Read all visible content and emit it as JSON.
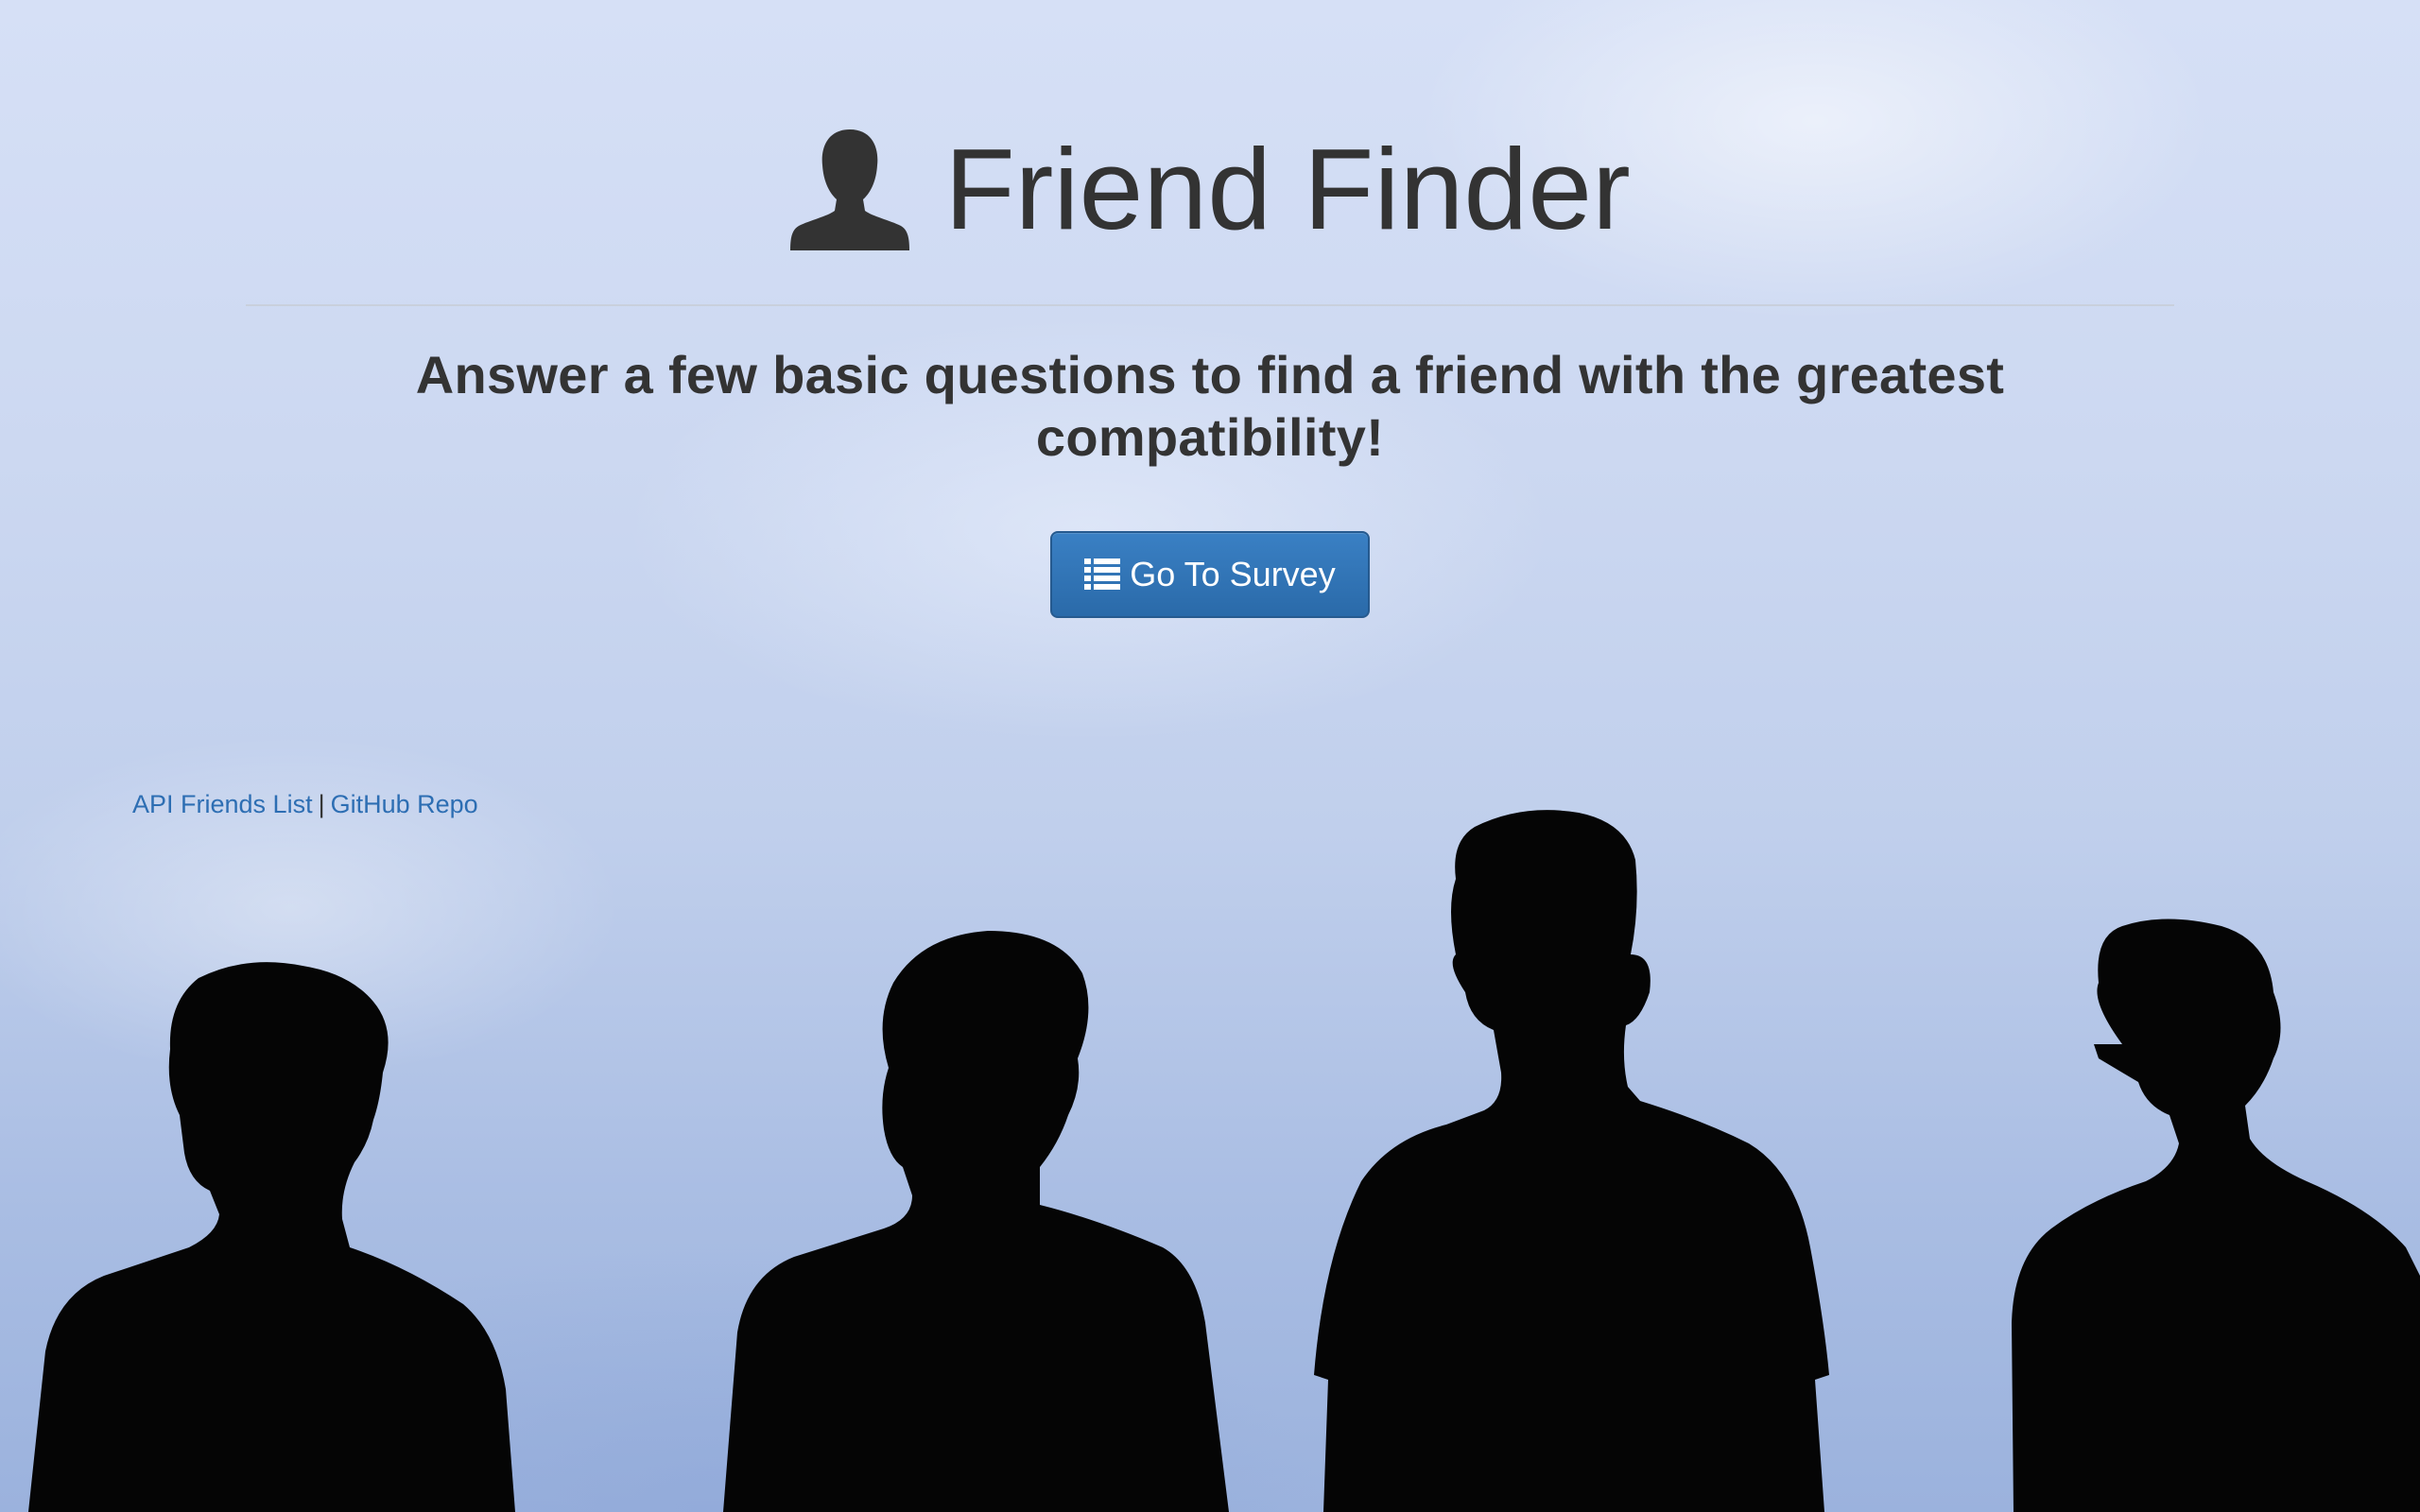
{
  "header": {
    "title": "Friend Finder",
    "title_icon": "user-icon"
  },
  "main": {
    "lead": "Answer a few basic questions to find a friend with the greatest compatibility!",
    "survey_button": {
      "label": "Go To Survey",
      "icon": "list-icon",
      "color": "#337ab7"
    }
  },
  "footer": {
    "api_link": "API Friends List",
    "separator": "|",
    "github_link": "GitHub Repo",
    "link_color": "#2d6eb3"
  },
  "background": {
    "description_icon": "people-silhouettes",
    "sky_color": "#c8d5ef"
  }
}
